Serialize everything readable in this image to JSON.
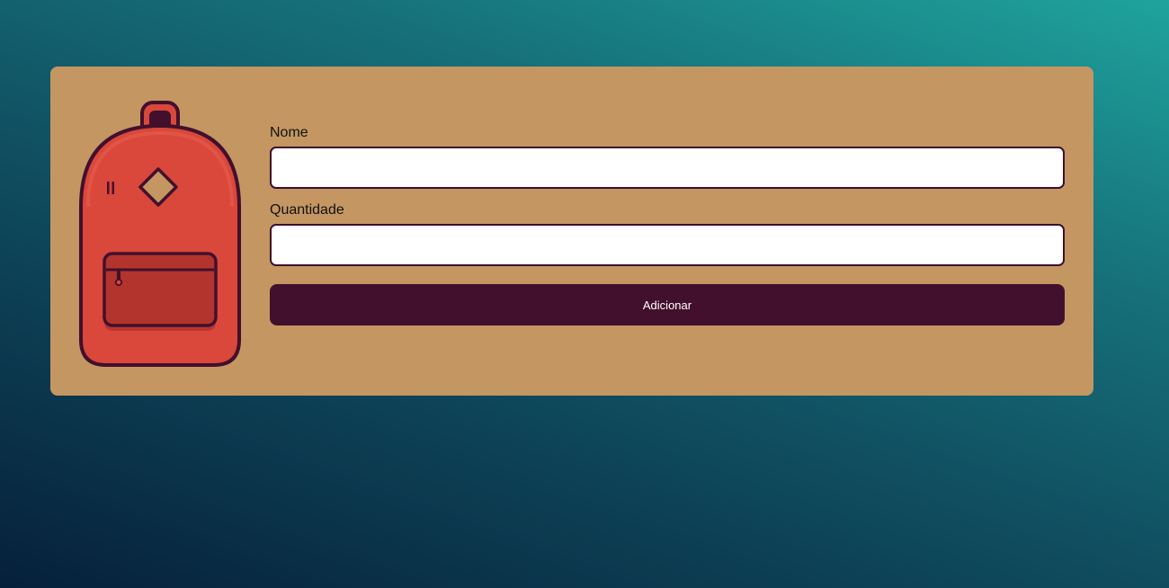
{
  "form": {
    "nome_label": "Nome",
    "nome_value": "",
    "quantidade_label": "Quantidade",
    "quantidade_value": "",
    "submit_label": "Adicionar"
  },
  "colors": {
    "card": "#c49662",
    "button": "#42102d",
    "border": "#3e0f2c",
    "backpack": "#d9483b"
  },
  "icons": {
    "illustration": "backpack-icon",
    "spinner": "number-spinner-icon"
  }
}
